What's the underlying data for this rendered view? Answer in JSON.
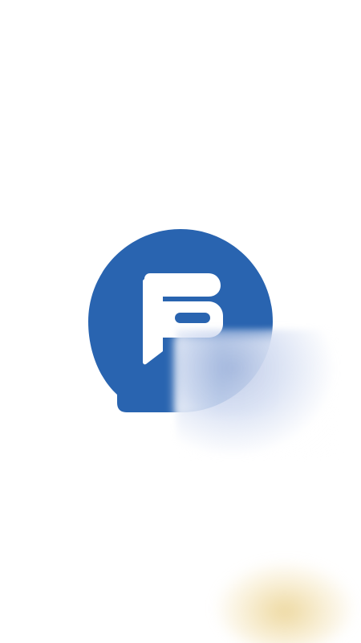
{
  "splash": {
    "logo_icon": "chat-bubble-f-icon",
    "colors": {
      "background": "#ffffff",
      "brand": "#2964b0",
      "logo_glyph": "#ffffff",
      "glow": "#e6c878"
    }
  }
}
